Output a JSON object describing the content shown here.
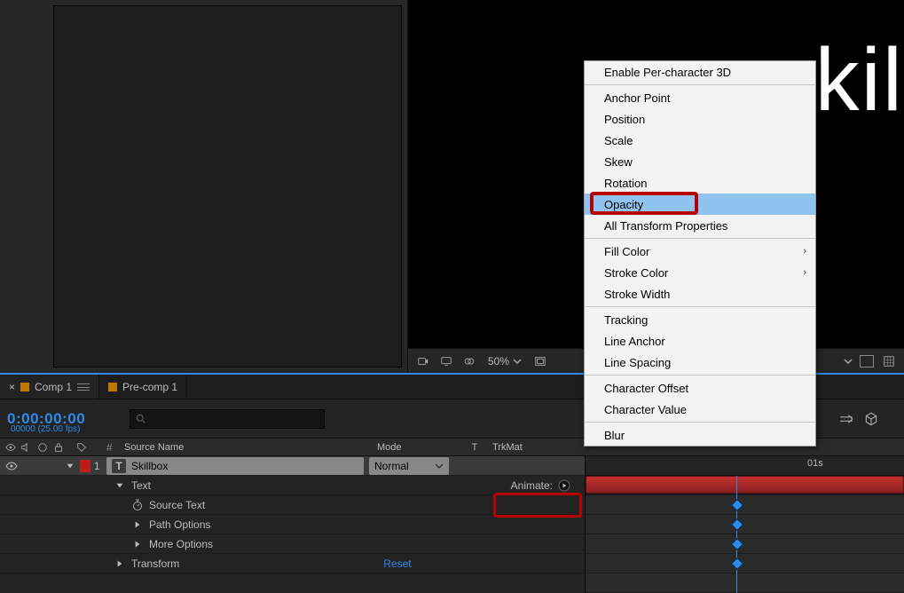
{
  "viewer": {
    "text_fragment": "kil",
    "zoom_label": "50%"
  },
  "timeline": {
    "tabs": [
      {
        "label": "Comp 1",
        "active": true
      },
      {
        "label": "Pre-comp 1",
        "active": false
      }
    ],
    "timecode": "0:00:00:00",
    "timecode_sub": "00000 (25.00 fps)",
    "search_placeholder": "",
    "columns": {
      "num": "#",
      "source_name": "Source Name",
      "mode": "Mode",
      "t": "T",
      "trkmat": "TrkMat"
    },
    "ruler": {
      "t0": "01s"
    },
    "layer": {
      "index": "1",
      "name": "Skillbox",
      "mode": "Normal",
      "groups": {
        "text": "Text",
        "source_text": "Source Text",
        "path_options": "Path Options",
        "more_options": "More Options",
        "transform": "Transform",
        "reset": "Reset",
        "animate": "Animate:"
      }
    }
  },
  "context_menu": {
    "items": [
      {
        "label": "Enable Per-character 3D",
        "type": "item"
      },
      {
        "type": "sep"
      },
      {
        "label": "Anchor Point",
        "type": "item"
      },
      {
        "label": "Position",
        "type": "item"
      },
      {
        "label": "Scale",
        "type": "item"
      },
      {
        "label": "Skew",
        "type": "item"
      },
      {
        "label": "Rotation",
        "type": "item"
      },
      {
        "label": "Opacity",
        "type": "item",
        "highlight": true
      },
      {
        "label": "All Transform Properties",
        "type": "item"
      },
      {
        "type": "sep"
      },
      {
        "label": "Fill Color",
        "type": "item",
        "submenu": true
      },
      {
        "label": "Stroke Color",
        "type": "item",
        "submenu": true
      },
      {
        "label": "Stroke Width",
        "type": "item"
      },
      {
        "type": "sep"
      },
      {
        "label": "Tracking",
        "type": "item"
      },
      {
        "label": "Line Anchor",
        "type": "item"
      },
      {
        "label": "Line Spacing",
        "type": "item"
      },
      {
        "type": "sep"
      },
      {
        "label": "Character Offset",
        "type": "item"
      },
      {
        "label": "Character Value",
        "type": "item"
      },
      {
        "type": "sep"
      },
      {
        "label": "Blur",
        "type": "item"
      }
    ]
  }
}
